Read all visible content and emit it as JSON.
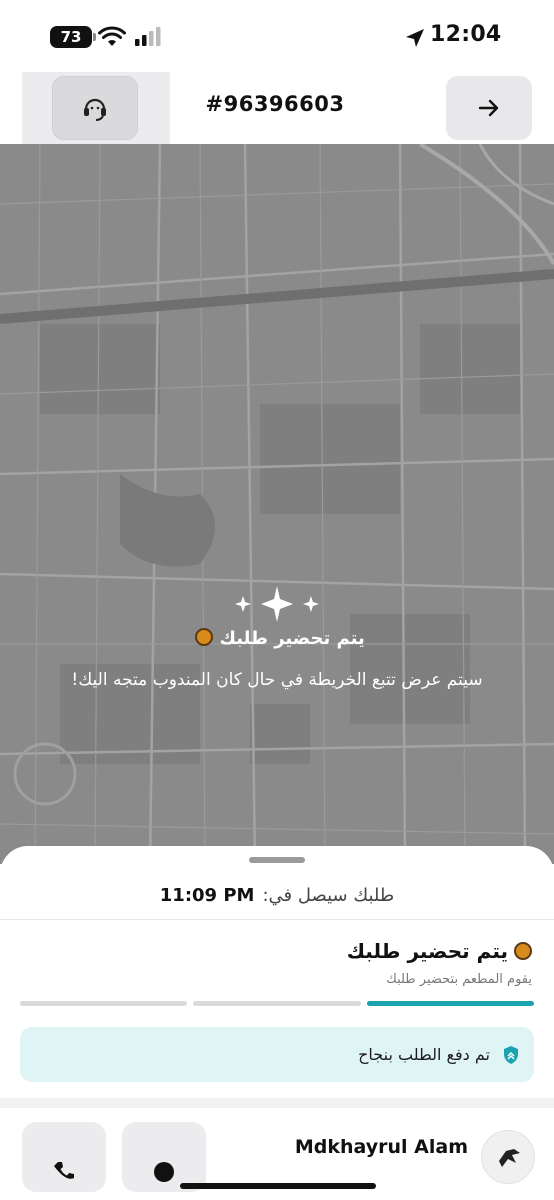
{
  "status_bar": {
    "battery": "73",
    "time": "12:04",
    "icons": [
      "wifi-icon",
      "cellular-signal-icon",
      "location-arrow-icon"
    ]
  },
  "header": {
    "order_number": "#96396603",
    "support_icon": "headset-support-icon",
    "back_icon": "arrow-right-icon"
  },
  "map": {
    "sparkle_icon": "sparkles-icon",
    "preparing_title": "يتم تحضير طلبك",
    "preparing_subtitle": "سيتم عرض تتبع الخريطة في حال كان المندوب متجه اليك!",
    "title_icon": "cooking-pan-icon"
  },
  "sheet": {
    "eta_label": "طلبك سيصل في:",
    "eta_time": "11:09 PM",
    "status_title": "يتم تحضير طلبك",
    "status_subtitle": "يقوم المطعم بتحضير طلبك",
    "progress_steps": 3,
    "progress_active_step": 1,
    "paid_message": "تم دفع الطلب بنجاح",
    "paid_icon": "shield-check-icon",
    "driver_name": "Mdkhayrul Alam",
    "call_icon": "phone-icon",
    "chat_icon": "chat-bubble-icon",
    "avatar_icon": "courier-avatar-icon"
  },
  "colors": {
    "accent": "#1ba3b0",
    "banner_bg": "#dff4f5",
    "map_overlay": "#8c8c8c"
  }
}
